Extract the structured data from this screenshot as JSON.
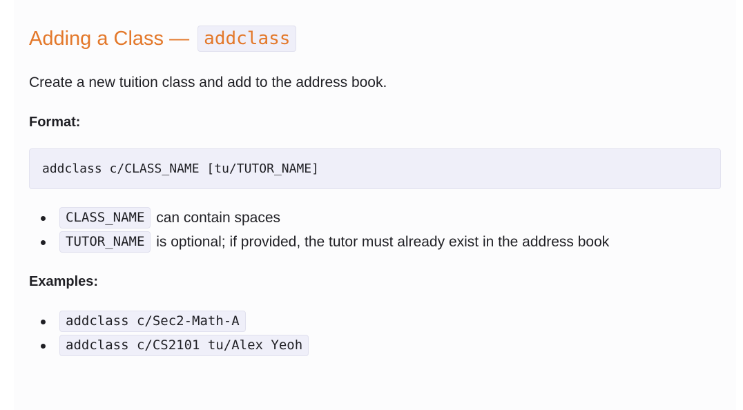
{
  "heading": {
    "text": "Adding a Class — ",
    "code": "addclass"
  },
  "intro": "Create a new tuition class and add to the address book.",
  "format": {
    "label": "Format:",
    "code": "addclass c/CLASS_NAME [tu/TUTOR_NAME]"
  },
  "notes": [
    {
      "code": "CLASS_NAME",
      "text": " can contain spaces"
    },
    {
      "code": "TUTOR_NAME",
      "text": " is optional; if provided, the tutor must already exist in the address book"
    }
  ],
  "examples": {
    "label": "Examples:",
    "items": [
      "addclass c/Sec2-Math-A",
      "addclass c/CS2101 tu/Alex Yeoh"
    ]
  }
}
